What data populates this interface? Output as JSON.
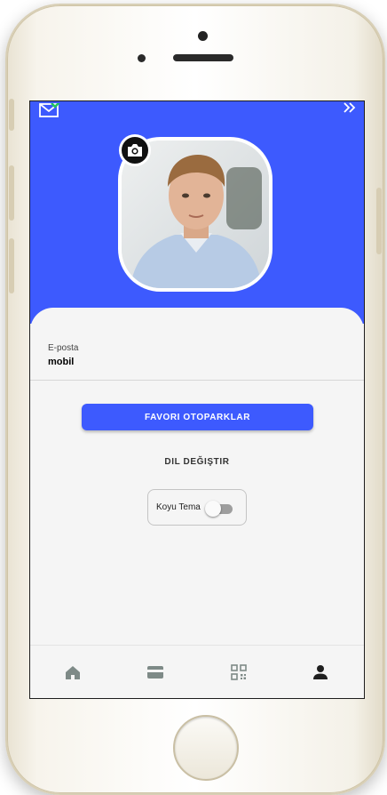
{
  "profile": {
    "email_label": "E-posta",
    "email_value": "mobil"
  },
  "actions": {
    "favorites_label": "FAVORI OTOPARKLAR",
    "change_language_label": "DIL DEĞIŞTIR"
  },
  "theme": {
    "dark_theme_label": "Koyu Tema",
    "dark_theme_enabled": false
  },
  "icons": {
    "top_left": "mail-icon",
    "top_right": "double-chevron-right-icon",
    "avatar_action": "camera-icon",
    "nav": [
      "home-icon",
      "card-icon",
      "qr-code-icon",
      "person-icon"
    ]
  },
  "colors": {
    "primary": "#3d5afe",
    "background": "#f5f5f5",
    "nav_icon": "#7e8a87",
    "nav_icon_active": "#1f1f1f",
    "mail_badge": "#22c55e"
  }
}
